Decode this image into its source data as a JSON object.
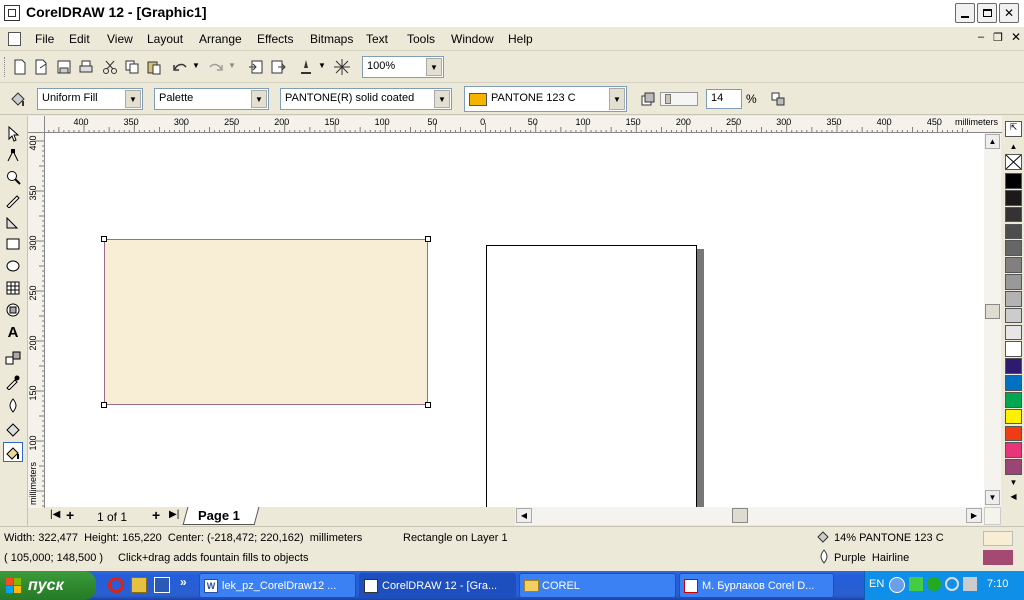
{
  "window": {
    "title": "CorelDRAW 12 - [Graphic1]"
  },
  "menu": [
    "File",
    "Edit",
    "View",
    "Layout",
    "Arrange",
    "Effects",
    "Bitmaps",
    "Text",
    "Tools",
    "Window",
    "Help"
  ],
  "toolbar": {
    "zoom": "100%"
  },
  "property_bar": {
    "fill_type": "Uniform Fill",
    "palette_type": "Palette",
    "palette_name": "PANTONE(R) solid coated",
    "color_name": "PANTONE 123 C",
    "color_hex": "#f4b400",
    "tint_value": "14",
    "tint_unit": "%"
  },
  "ruler": {
    "h_labels": [
      "400",
      "350",
      "300",
      "250",
      "200",
      "150",
      "100",
      "50",
      "0",
      "50",
      "100",
      "150",
      "200",
      "250",
      "300",
      "350",
      "400",
      "450"
    ],
    "h_units": "millimeters",
    "v_labels": [
      "400",
      "350",
      "300",
      "250",
      "200",
      "150",
      "100"
    ],
    "v_units": "millimeters"
  },
  "page_nav": {
    "count": "1 of 1",
    "page_tab": "Page 1"
  },
  "status": {
    "dimensions": "Width: 322,477  Height: 165,220  Center: (-218,472; 220,162)  millimeters",
    "object_info": "Rectangle on Layer 1",
    "cursor_pos": "( 105,000; 148,500 )",
    "hint": "Click+drag adds fountain fills to objects",
    "fill_info": "14% PANTONE 123 C",
    "fill_swatch": "#f7eed5",
    "outline_info": "Purple  Hairline",
    "outline_swatch": "#a44a72"
  },
  "palette_colors": [
    "#000000",
    "#1a1a1a",
    "#333333",
    "#4d4d4d",
    "#666666",
    "#808080",
    "#999999",
    "#b3b3b3",
    "#cccccc",
    "#e6e6e6",
    "#ffffff",
    "#2e1a6e",
    "#0070c0",
    "#00a651",
    "#ffef00",
    "#f03c14",
    "#e8357a",
    "#9a4674"
  ],
  "taskbar": {
    "start_label": "пуск",
    "tasks": [
      "lek_pz_CorelDraw12 ...",
      "CorelDRAW 12 - [Gra...",
      "COREL",
      "М. Бурлаков Corel D..."
    ],
    "lang": "EN",
    "clock": "7:10"
  }
}
